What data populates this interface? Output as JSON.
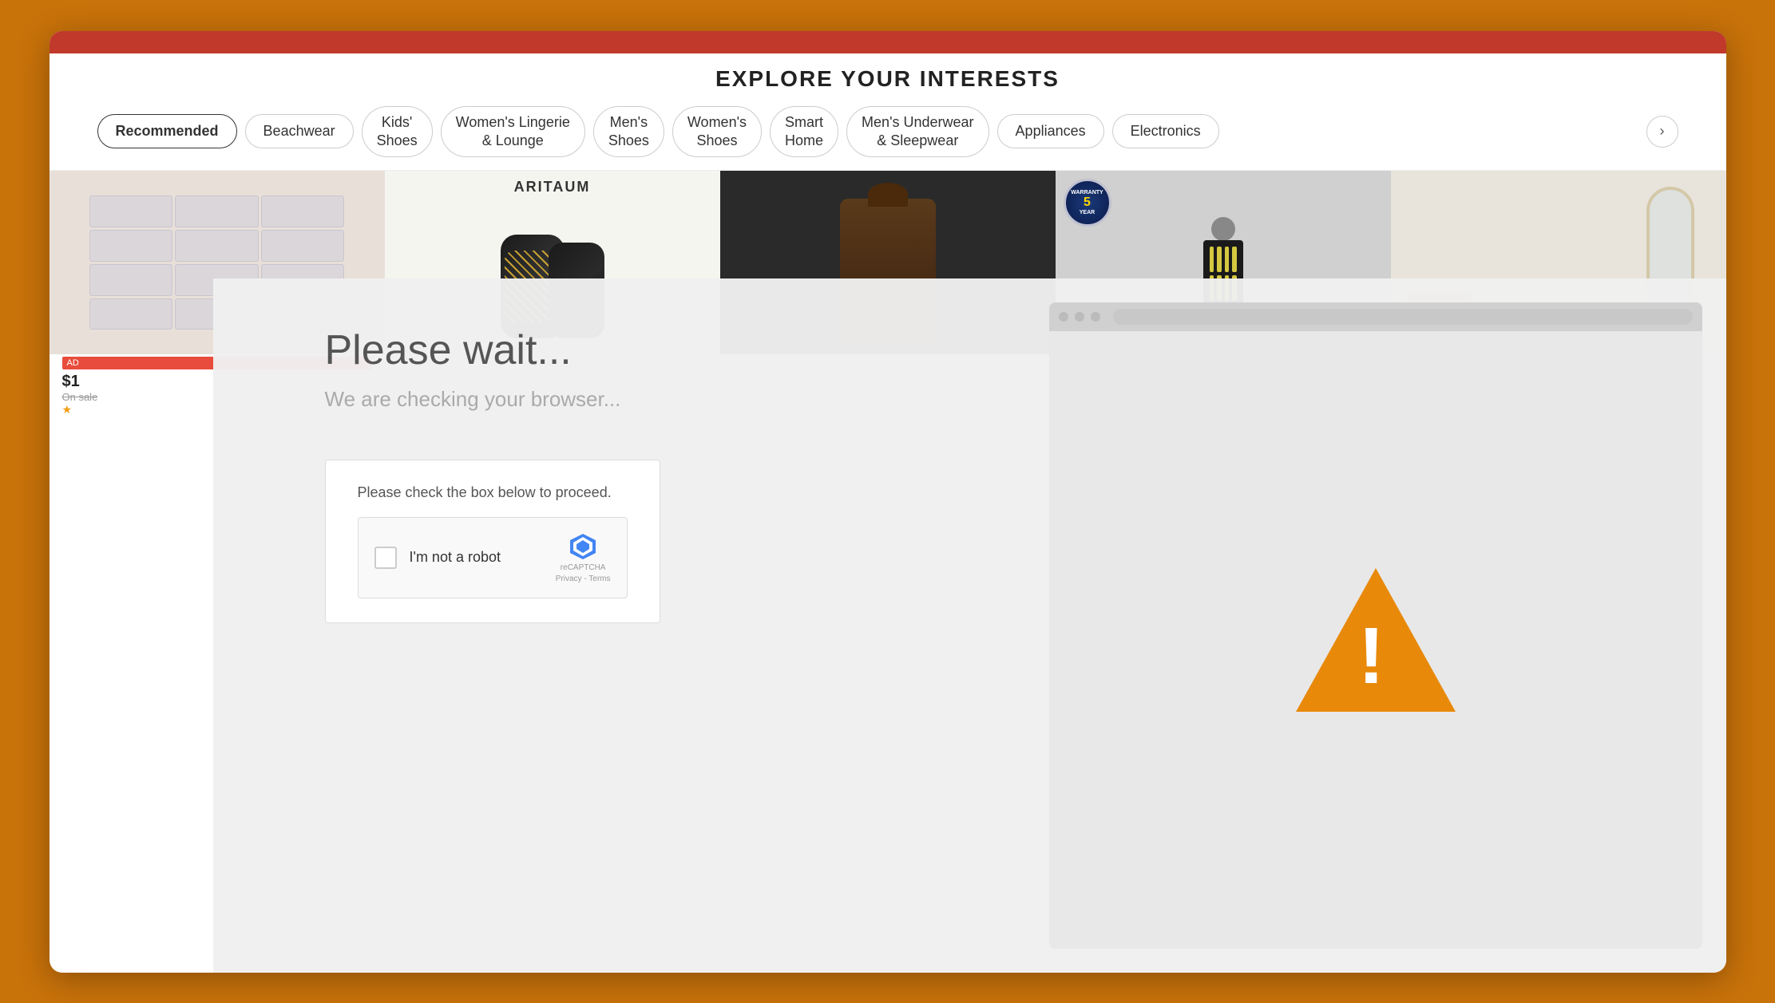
{
  "page": {
    "title": "EXPLORE YOUR INTERESTS",
    "background_color": "#c8720a"
  },
  "topbar": {
    "background": "#c0392b"
  },
  "categories": {
    "tabs": [
      {
        "id": "recommended",
        "label": "Recommended",
        "active": true
      },
      {
        "id": "beachwear",
        "label": "Beachwear",
        "active": false
      },
      {
        "id": "kids-shoes",
        "label": "Kids'\nShoes",
        "active": false
      },
      {
        "id": "womens-lingerie",
        "label": "Women's Lingerie\n& Lounge",
        "active": false
      },
      {
        "id": "mens-shoes",
        "label": "Men's\nShoes",
        "active": false
      },
      {
        "id": "womens-shoes",
        "label": "Women's\nShoes",
        "active": false
      },
      {
        "id": "smart-home",
        "label": "Smart\nHome",
        "active": false
      },
      {
        "id": "mens-underwear",
        "label": "Men's Underwear\n& Sleepwear",
        "active": false
      },
      {
        "id": "appliances",
        "label": "Appliances",
        "active": false
      },
      {
        "id": "electronics",
        "label": "Electronics",
        "active": false
      }
    ],
    "chevron_label": "›"
  },
  "products": [
    {
      "id": 1,
      "type": "shoe-organizer",
      "badge": "AD",
      "price": "$1",
      "original_price": "",
      "stars": "★"
    },
    {
      "id": 2,
      "type": "knee-brace",
      "brand": "ARITAUM"
    },
    {
      "id": 3,
      "type": "jacket"
    },
    {
      "id": 4,
      "type": "led-panel",
      "warranty": "5 YEAR",
      "badge_text": "WARRANTY"
    },
    {
      "id": 5,
      "type": "mirror"
    }
  ],
  "captcha_overlay": {
    "please_wait": "Please wait...",
    "checking": "We are checking your browser...",
    "instruction": "Please check the box below to proceed.",
    "not_robot_label": "I'm not a robot",
    "recaptcha_label": "reCAPTCHA",
    "recaptcha_privacy": "Privacy - Terms"
  },
  "browser_mockup": {
    "dots": [
      "●",
      "●",
      "●"
    ]
  },
  "warning": {
    "icon": "!"
  }
}
